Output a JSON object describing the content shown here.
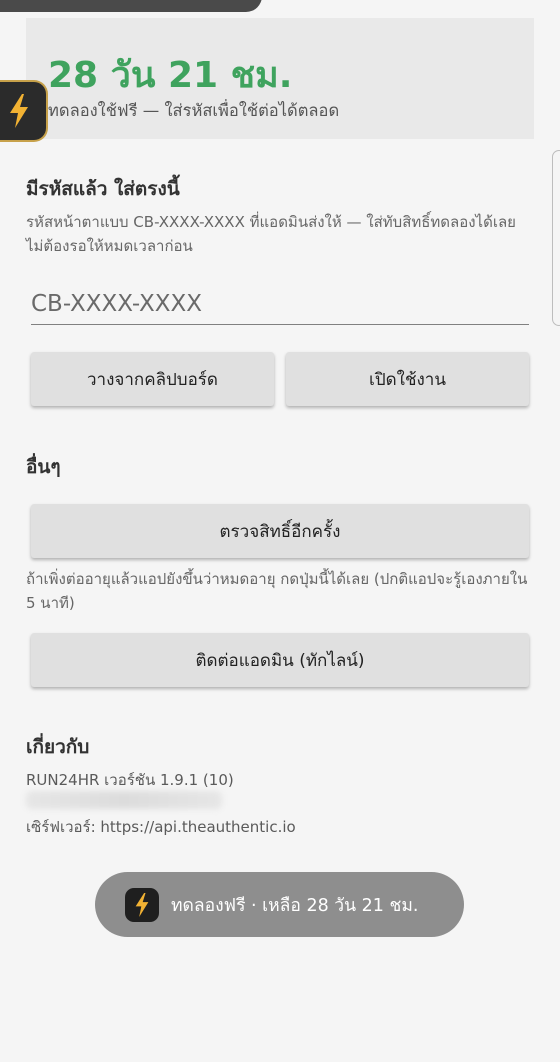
{
  "trial": {
    "days_left": "28 วัน 21 ชม.",
    "subtitle": "ทดลองใช้ฟรี — ใส่รหัสเพื่อใช้ต่อได้ตลอด"
  },
  "redeem": {
    "title": "มีรหัสแล้ว ใส่ตรงนี้",
    "helper": "รหัสหน้าตาแบบ CB-XXXX-XXXX ที่แอดมินส่งให้ — ใส่ทับสิทธิ์ทดลองได้เลย ไม่ต้องรอให้หมดเวลาก่อน",
    "code_placeholder": "CB-XXXX-XXXX",
    "paste_label": "วางจากคลิปบอร์ด",
    "activate_label": "เปิดใช้งาน"
  },
  "other": {
    "title": "อื่นๆ",
    "recheck_label": "ตรวจสิทธิ์อีกครั้ง",
    "recheck_helper": "ถ้าเพิ่งต่ออายุแล้วแอปยังขึ้นว่าหมดอายุ กดปุ่มนี้ได้เลย (ปกติแอปจะรู้เองภายใน 5 นาที)",
    "contact_label": "ติดต่อแอดมิน (ทักไลน์)"
  },
  "about": {
    "title": "เกี่ยวกับ",
    "version": "RUN24HR เวอร์ชัน 1.9.1 (10)",
    "server": "เซิร์ฟเวอร์: https://api.theauthentic.io"
  },
  "toast": {
    "text": "ทดลองฟรี · เหลือ 28 วัน 21 ชม."
  },
  "icons": {
    "bolt": "lightning-bolt-icon",
    "bolt_color": "#f2b233"
  },
  "colors": {
    "accent_green": "#3fa35e",
    "background": "#f5f5f5",
    "button": "#e0e0e0"
  }
}
